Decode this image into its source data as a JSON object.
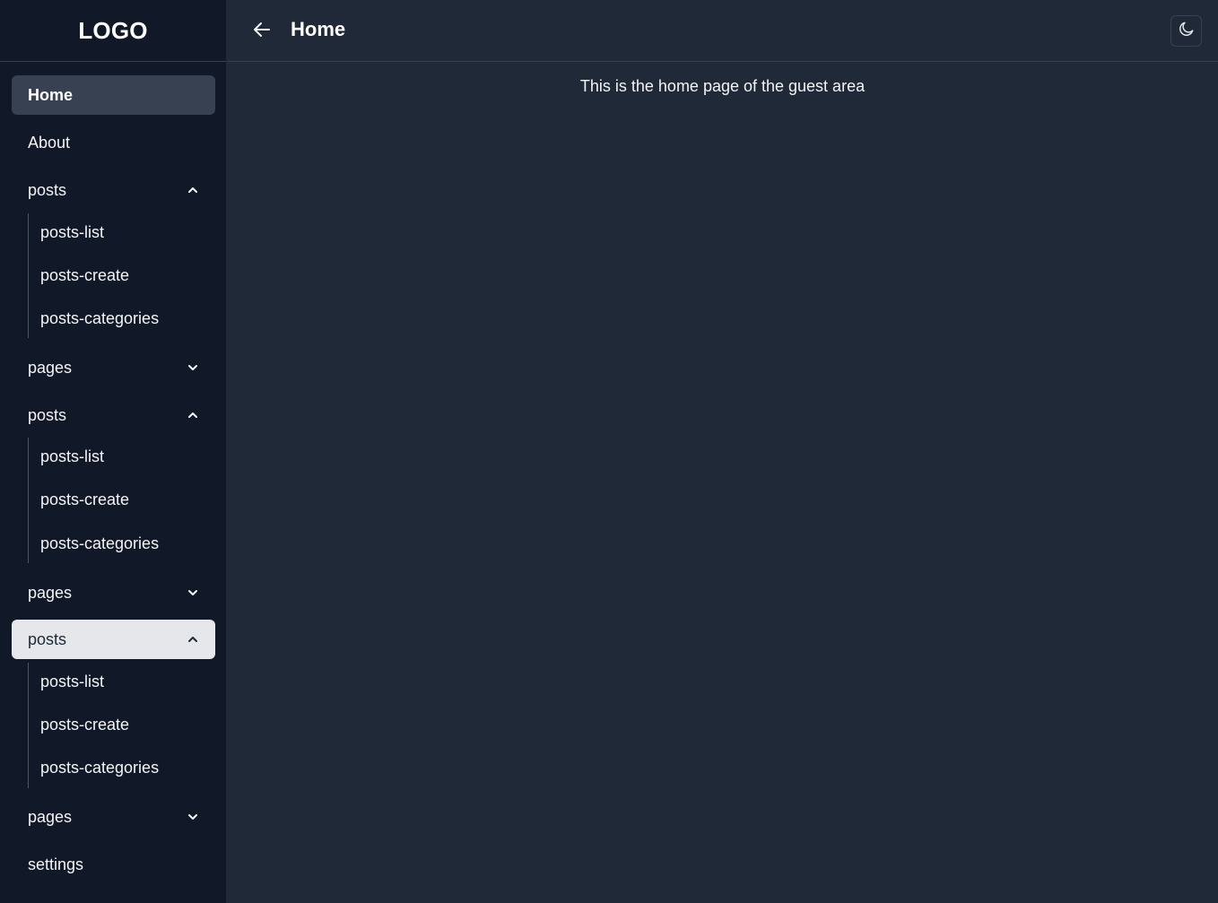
{
  "sidebar": {
    "logo": "LOGO",
    "items": [
      {
        "label": "Home",
        "state": "active"
      },
      {
        "label": "About"
      },
      {
        "label": "posts",
        "expanded": true,
        "children": [
          "posts-list",
          "posts-create",
          "posts-categories"
        ]
      },
      {
        "label": "pages",
        "expanded": false
      },
      {
        "label": "posts",
        "expanded": true,
        "children": [
          "posts-list",
          "posts-create",
          "posts-categories"
        ]
      },
      {
        "label": "pages",
        "expanded": false
      },
      {
        "label": "posts",
        "expanded": true,
        "state": "highlighted",
        "children": [
          "posts-list",
          "posts-create",
          "posts-categories"
        ]
      },
      {
        "label": "pages",
        "expanded": false
      },
      {
        "label": "settings"
      }
    ]
  },
  "header": {
    "title": "Home",
    "back_icon": "arrow-left-icon",
    "theme_icon": "moon-icon"
  },
  "main": {
    "message": "This is the home page of the guest area"
  },
  "colors": {
    "sidebar_bg": "#111827",
    "main_bg": "#1f2937",
    "active_item_bg": "#374151",
    "highlight_item_bg": "#e5e7eb"
  }
}
